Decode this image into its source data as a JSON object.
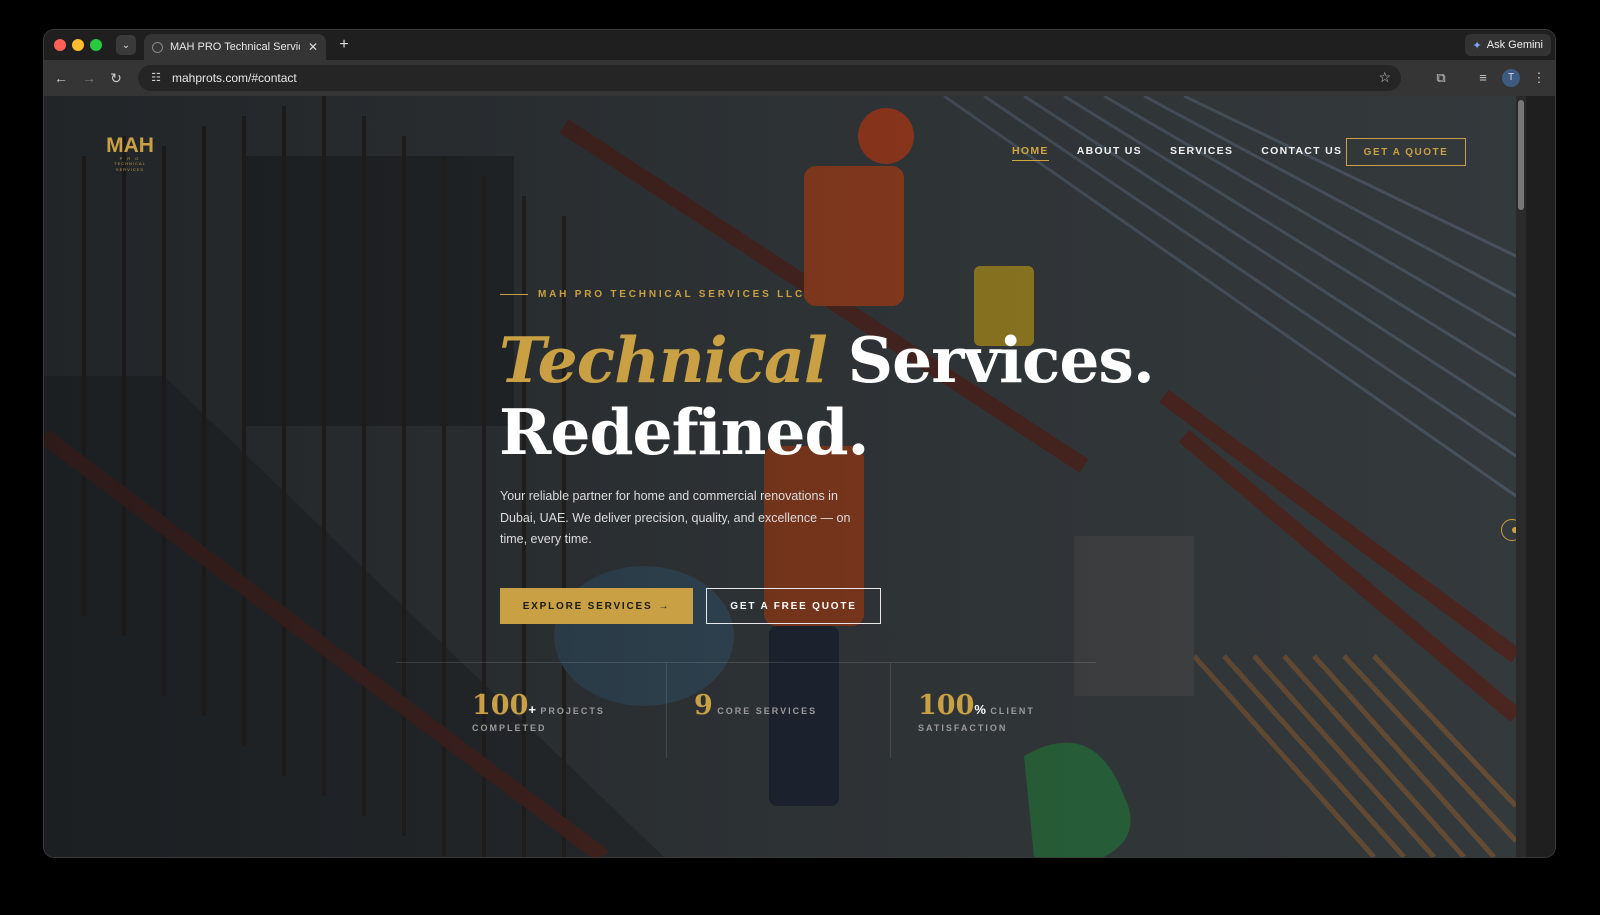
{
  "browser": {
    "tab_title": "MAH PRO Technical Services",
    "tab_close": "✕",
    "new_tab": "+",
    "url": "mahprots.com/#contact",
    "ask_gemini": "Ask Gemini",
    "profile_initial": "T",
    "traffic_lights": [
      "#ff5f57",
      "#febc2e",
      "#28c840"
    ]
  },
  "site": {
    "logo": {
      "main": "MAH",
      "sub": "P R O",
      "tagline": "TECHNICAL SERVICES"
    },
    "nav": [
      {
        "label": "HOME",
        "active": true
      },
      {
        "label": "ABOUT US",
        "active": false
      },
      {
        "label": "SERVICES",
        "active": false
      },
      {
        "label": "CONTACT US",
        "active": false
      }
    ],
    "quote_button": "GET A QUOTE",
    "accent_color": "#c9a043"
  },
  "hero": {
    "eyebrow": "MAH PRO TECHNICAL SERVICES LLC",
    "headline_accent": "Technical",
    "headline_rest": " Services.",
    "headline_line2": "Redefined.",
    "lead": "Your reliable partner for home and commercial renovations in Dubai, UAE. We deliver precision, quality, and excellence — on time, every time.",
    "primary_cta": "EXPLORE SERVICES",
    "primary_cta_arrow": "→",
    "secondary_cta": "GET A FREE QUOTE"
  },
  "stats": [
    {
      "number": "100",
      "suffix": "+",
      "label_line1": "PROJECTS",
      "label_line2": "COMPLETED"
    },
    {
      "number": "9",
      "suffix": "",
      "label_line1": "CORE SERVICES",
      "label_line2": ""
    },
    {
      "number": "100",
      "suffix": "%",
      "label_line1": "CLIENT",
      "label_line2": "SATISFACTION"
    }
  ]
}
